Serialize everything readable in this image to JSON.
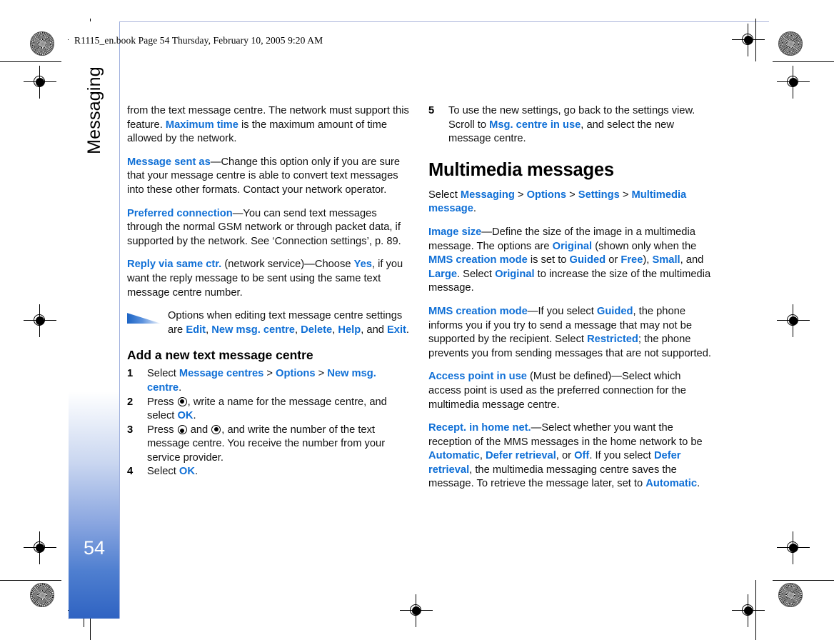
{
  "page": {
    "book_line": "R1115_en.book  Page 54  Thursday, February 10, 2005  9:20 AM",
    "chapter": "Messaging",
    "folio": "54",
    "accent_color": "#0f6fd6",
    "tab_color": "#2f63c2"
  },
  "left_column": {
    "p1": {
      "t1": "from the text message centre. The network must support this feature. ",
      "k1": "Maximum time",
      "t2": " is the maximum amount of time allowed by the network."
    },
    "p2": {
      "k1": "Message sent as",
      "t1": "—Change this option only if you are sure that your message centre is able to convert text messages into these other formats. Contact your network operator."
    },
    "p3": {
      "k1": "Preferred connection",
      "t1": "—You can send text messages through the normal GSM network or through packet data, if supported by the network. See ‘Connection settings’, p. 89."
    },
    "p4": {
      "k1": "Reply via same ctr.",
      "t1": " (network service)—Choose ",
      "k2": "Yes",
      "t2": ", if you want the reply message to be sent using the same text message centre number."
    },
    "tip": {
      "icon": "tip-triangle-icon",
      "t1": "Options when editing text message centre settings are ",
      "k1": "Edit",
      "t2": ", ",
      "k2": "New msg. centre",
      "t3": ", ",
      "k3": "Delete",
      "t4": ", ",
      "k4": "Help",
      "t5": ", and ",
      "k5": "Exit",
      "t6": "."
    },
    "heading": "Add a new text message centre",
    "steps": [
      {
        "num": "1",
        "t1": "Select ",
        "k1": "Message centres",
        "t2": " > ",
        "k2": "Options",
        "t3": " > ",
        "k3": "New msg. centre",
        "t4": "."
      },
      {
        "num": "2",
        "t1": "Press ",
        "icon1": "select-key-icon",
        "t2": ", write a name for the message centre, and select ",
        "k1": "OK",
        "t3": "."
      },
      {
        "num": "3",
        "t1": "Press ",
        "icon1": "scroll-down-key-icon",
        "t2": " and ",
        "icon2": "select-key-icon",
        "t3": ", and write the number of the text message centre. You receive the number from your service provider."
      },
      {
        "num": "4",
        "t1": "Select ",
        "k1": "OK",
        "t2": "."
      }
    ]
  },
  "right_column": {
    "step5": {
      "num": "5",
      "t1": "To use the new settings, go back to the settings view. Scroll to ",
      "k1": "Msg. centre in use",
      "t2": ", and select the new message centre."
    },
    "heading": "Multimedia messages",
    "p_select": {
      "t1": "Select ",
      "k1": "Messaging",
      "t2": " > ",
      "k2": "Options",
      "t3": " > ",
      "k3": "Settings",
      "t4": " > ",
      "k4": "Multimedia message",
      "t5": "."
    },
    "p_image_size": {
      "k1": "Image size",
      "t1": "—Define the size of the image in a multimedia message. The options are ",
      "k2": "Original",
      "t2": " (shown only when the ",
      "k3": "MMS creation mode",
      "t3": " is set to ",
      "k4": "Guided",
      "t4": " or ",
      "k5": "Free",
      "t5": "), ",
      "k6": "Small",
      "t6": ", and ",
      "k7": "Large",
      "t7": ". Select ",
      "k8": "Original",
      "t8": " to increase the size of the multimedia message."
    },
    "p_mms_mode": {
      "k1": "MMS creation mode",
      "t1": "—If you select ",
      "k2": "Guided",
      "t2": ", the phone informs you if you try to send a message that may not be supported by the recipient. Select ",
      "k3": "Restricted",
      "t3": "; the phone prevents you from sending messages that are not supported."
    },
    "p_access_point": {
      "k1": "Access point in use",
      "t1": " (Must be defined)—Select which access point is used as the preferred connection for the multimedia message centre."
    },
    "p_recept": {
      "k1": "Recept. in home net.",
      "t1": "—Select whether you want the reception of the MMS messages in the home network to be ",
      "k2": "Automatic",
      "t2": ", ",
      "k3": "Defer retrieval",
      "t3": ", or ",
      "k4": "Off",
      "t4": ". If you select ",
      "k5": "Defer retrieval",
      "t5": ", the multimedia messaging centre saves the message. To retrieve the message later, set to ",
      "k6": "Automatic",
      "t6": "."
    }
  }
}
